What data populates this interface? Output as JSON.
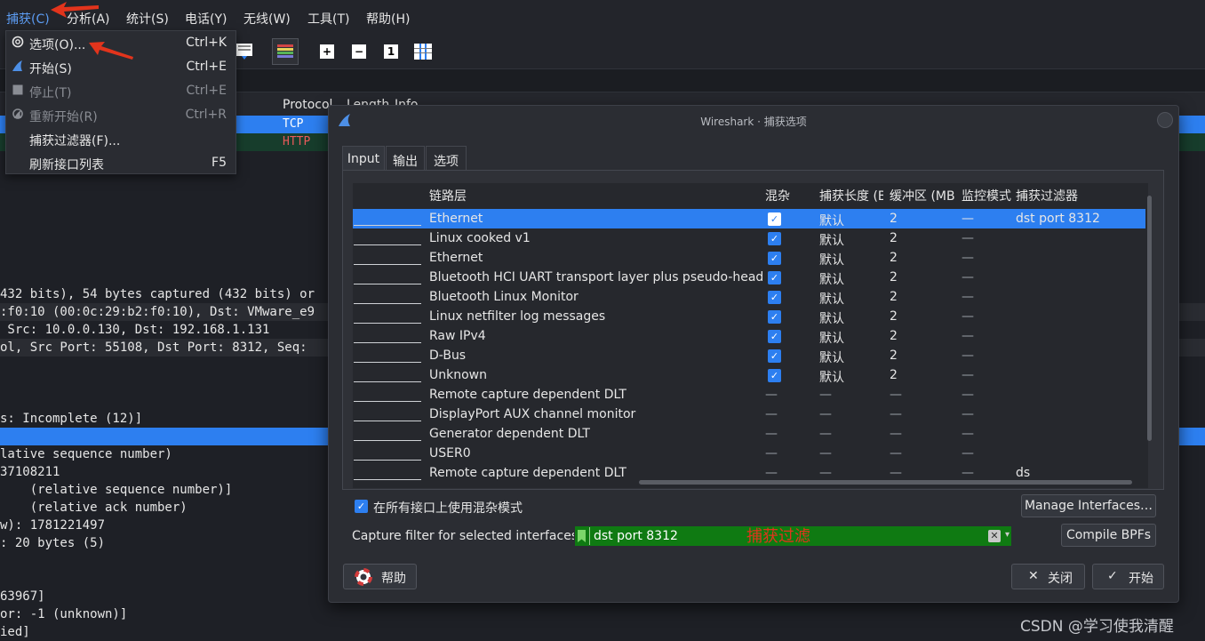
{
  "menubar": {
    "items": [
      "捕获(C)",
      "分析(A)",
      "统计(S)",
      "电话(Y)",
      "无线(W)",
      "工具(T)",
      "帮助(H)"
    ]
  },
  "packet_list": {
    "headers": [
      "Protocol",
      "Length",
      "Info"
    ],
    "rows": [
      {
        "protocol": "TCP"
      },
      {
        "protocol": "HTTP"
      }
    ]
  },
  "details": {
    "lines": [
      "432 bits), 54 bytes captured (432 bits) or",
      ":f0:10 (00:0c:29:b2:f0:10), Dst: VMware_e9",
      " Src: 10.0.0.130, Dst: 192.168.1.131",
      "ol, Src Port: 55108, Dst Port: 8312, Seq:",
      "s: Incomplete (12)]",
      "",
      "lative sequence number)",
      "37108211",
      "    (relative sequence number)]",
      "    (relative ack number)",
      "w): 1781221497",
      ": 20 bytes (5)",
      "63967]",
      "or: -1 (unknown)]",
      "ied]"
    ]
  },
  "capture_menu": {
    "items": [
      {
        "label": "选项(O)...",
        "shortcut": "Ctrl+K"
      },
      {
        "label": "开始(S)",
        "shortcut": "Ctrl+E"
      },
      {
        "label": "停止(T)",
        "shortcut": "Ctrl+E"
      },
      {
        "label": "重新开始(R)",
        "shortcut": "Ctrl+R"
      },
      {
        "label": "捕获过滤器(F)...",
        "shortcut": ""
      },
      {
        "label": "刷新接口列表",
        "shortcut": "F5"
      }
    ]
  },
  "dialog": {
    "title": "Wireshark · 捕获选项",
    "tabs": [
      "Input",
      "输出",
      "选项"
    ],
    "table": {
      "headers": [
        "链路层",
        "混杂",
        "捕获长度 (B",
        "缓冲区 (MB",
        "监控模式",
        "捕获过滤器"
      ],
      "rows": [
        {
          "link": "Ethernet",
          "promisc": true,
          "snaplen": "默认",
          "buffer": "2",
          "monitor": "—",
          "filter": "dst port 8312"
        },
        {
          "link": "Linux cooked v1",
          "promisc": true,
          "snaplen": "默认",
          "buffer": "2",
          "monitor": "—",
          "filter": ""
        },
        {
          "link": "Ethernet",
          "promisc": true,
          "snaplen": "默认",
          "buffer": "2",
          "monitor": "—",
          "filter": ""
        },
        {
          "link": "Bluetooth HCI UART transport layer plus pseudo-header",
          "promisc": true,
          "snaplen": "默认",
          "buffer": "2",
          "monitor": "—",
          "filter": ""
        },
        {
          "link": "Bluetooth Linux Monitor",
          "promisc": true,
          "snaplen": "默认",
          "buffer": "2",
          "monitor": "—",
          "filter": ""
        },
        {
          "link": "Linux netfilter log messages",
          "promisc": true,
          "snaplen": "默认",
          "buffer": "2",
          "monitor": "—",
          "filter": ""
        },
        {
          "link": "Raw IPv4",
          "promisc": true,
          "snaplen": "默认",
          "buffer": "2",
          "monitor": "—",
          "filter": ""
        },
        {
          "link": "D-Bus",
          "promisc": true,
          "snaplen": "默认",
          "buffer": "2",
          "monitor": "—",
          "filter": ""
        },
        {
          "link": "Unknown",
          "promisc": true,
          "snaplen": "默认",
          "buffer": "2",
          "monitor": "—",
          "filter": ""
        },
        {
          "link": "Remote capture dependent DLT",
          "promisc": false,
          "snaplen": "—",
          "buffer": "—",
          "monitor": "—",
          "filter": ""
        },
        {
          "link": "DisplayPort AUX channel monitor",
          "promisc": false,
          "snaplen": "—",
          "buffer": "—",
          "monitor": "—",
          "filter": ""
        },
        {
          "link": "Generator dependent DLT",
          "promisc": false,
          "snaplen": "—",
          "buffer": "—",
          "monitor": "—",
          "filter": ""
        },
        {
          "link": "USER0",
          "promisc": false,
          "snaplen": "—",
          "buffer": "—",
          "monitor": "—",
          "filter": ""
        },
        {
          "link": "Remote capture dependent DLT",
          "promisc": false,
          "snaplen": "—",
          "buffer": "—",
          "monitor": "—",
          "filter": "ds"
        }
      ]
    },
    "promisc_all_label": "在所有接口上使用混杂模式",
    "manage_interfaces_label": "Manage Interfaces…",
    "capture_filter_label": "Capture filter for selected interfaces:",
    "capture_filter_value": "dst port 8312",
    "compile_bpfs_label": "Compile BPFs",
    "help_label": "帮助",
    "close_label": "关闭",
    "start_label": "开始"
  },
  "annotation_text": "捕获过滤",
  "watermark": "CSDN @学习使我清醒",
  "colors": {
    "selection": "#2d7ff0",
    "filter_valid": "#0f7a12",
    "annotation": "#e2341c",
    "tcp_row": "#2d7ff0",
    "http_row": "#173d2c"
  }
}
